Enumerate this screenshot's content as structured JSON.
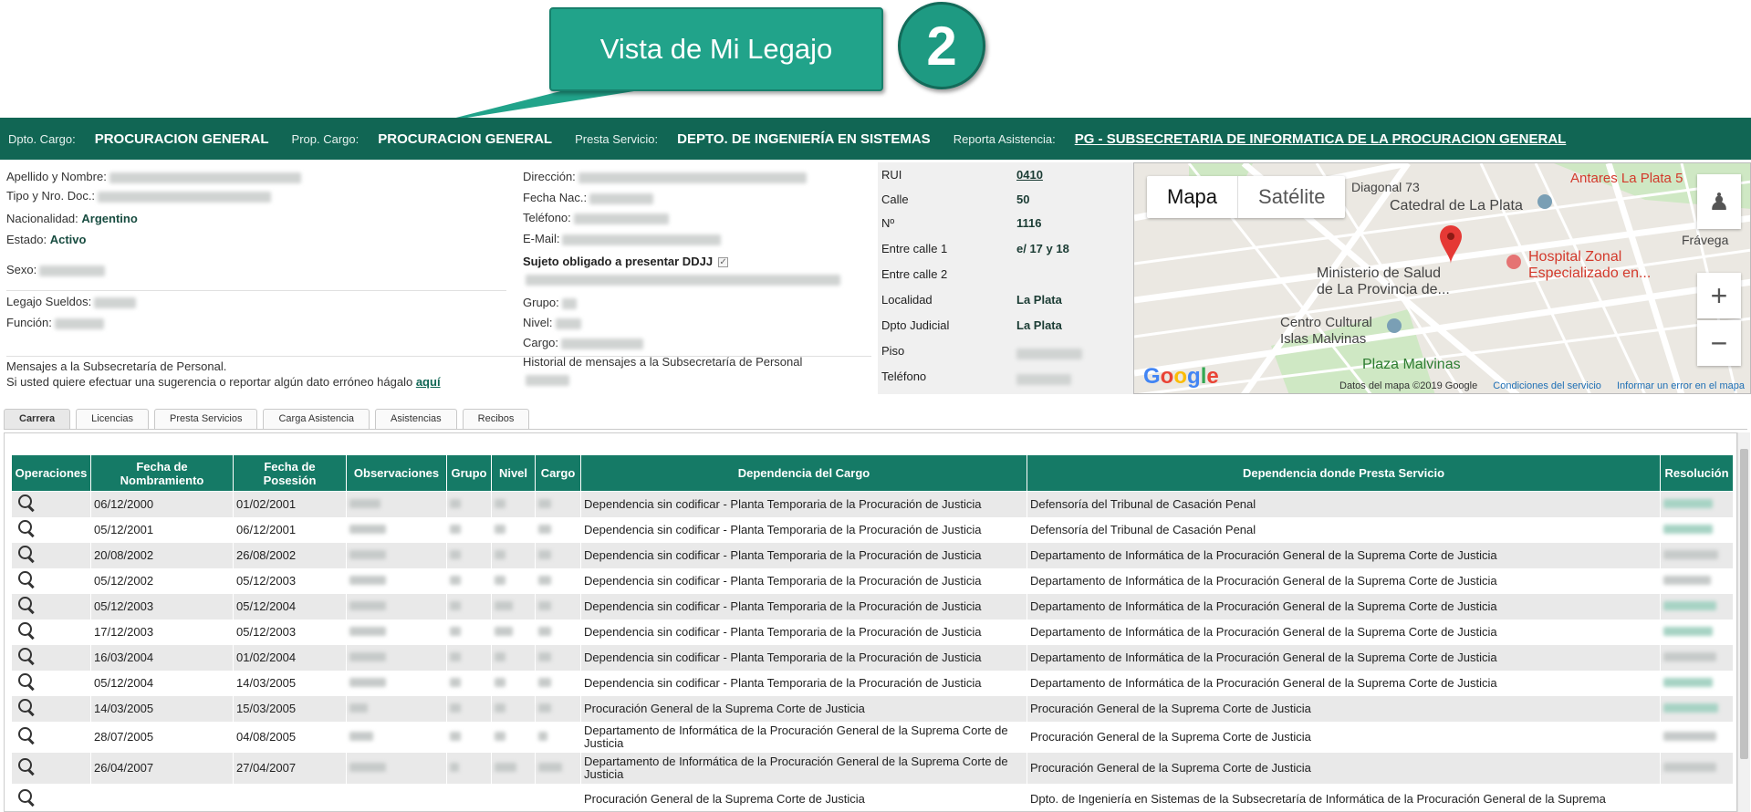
{
  "callout": {
    "text": "Vista de Mi Legajo",
    "badge": "2"
  },
  "topbar": {
    "dpto_label": "Dpto. Cargo:",
    "dpto_value": "PROCURACION GENERAL",
    "prop_label": "Prop. Cargo:",
    "prop_value": "PROCURACION GENERAL",
    "presta_label": "Presta Servicio:",
    "presta_value": "DEPTO. DE INGENIERÍA EN SISTEMAS",
    "reporta_label": "Reporta Asistencia:",
    "reporta_value": "PG - SUBSECRETARIA DE INFORMATICA DE LA PROCURACION GENERAL"
  },
  "personal": {
    "apellido_label": "Apellido y Nombre:",
    "tipo_doc_label": "Tipo y Nro. Doc.:",
    "nacionalidad_label": "Nacionalidad:",
    "nacionalidad_value": "Argentino",
    "estado_label": "Estado:",
    "estado_value": "Activo",
    "sexo_label": "Sexo:",
    "legajo_label": "Legajo Sueldos:",
    "funcion_label": "Función:",
    "mensajes_line1": "Mensajes a la Subsecretaría de Personal.",
    "mensajes_line2": "Si usted quiere efectuar una sugerencia o reportar algún dato erróneo hágalo",
    "mensajes_link": "aquí",
    "direccion_label": "Dirección:",
    "fecha_nac_label": "Fecha Nac.:",
    "telefono_label": "Teléfono:",
    "email_label": "E-Mail:",
    "ddjj_label": "Sujeto obligado a presentar DDJJ",
    "grupo_label": "Grupo:",
    "nivel_label": "Nivel:",
    "cargo_label": "Cargo:",
    "historial_label": "Historial de mensajes a la Subsecretaría de Personal"
  },
  "address": {
    "rui_label": "RUI",
    "rui_value": "0410",
    "calle_label": "Calle",
    "calle_value": "50",
    "nro_label": "Nº",
    "nro_value": "1116",
    "entre1_label": "Entre calle 1",
    "entre1_value": "e/ 17 y 18",
    "entre2_label": "Entre calle 2",
    "localidad_label": "Localidad",
    "localidad_value": "La Plata",
    "dpto_judicial_label": "Dpto Judicial",
    "dpto_judicial_value": "La Plata",
    "piso_label": "Piso",
    "telefono_label": "Teléfono"
  },
  "map": {
    "tab_mapa": "Mapa",
    "tab_satelite": "Satélite",
    "labels": {
      "diagonal73": "Diagonal 73",
      "catedral": "Catedral de La Plata",
      "antares": "Antares La Plata 5",
      "fravega": "Frávega",
      "hospital1": "Hospital Zonal",
      "hospital2": "Especializado en...",
      "ministerio1": "Ministerio de Salud",
      "ministerio2": "de La Provincia de...",
      "centro1": "Centro Cultural",
      "centro2": "Islas Malvinas",
      "plaza": "Plaza Malvinas"
    },
    "google": "Google",
    "datos": "Datos del mapa ©2019 Google",
    "condiciones": "Condiciones del servicio",
    "informar": "Informar un error en el mapa"
  },
  "tabs": [
    "Carrera",
    "Licencias",
    "Presta Servicios",
    "Carga Asistencia",
    "Asistencias",
    "Recibos"
  ],
  "table": {
    "headers": {
      "operaciones": "Operaciones",
      "fecha_nombramiento": "Fecha de Nombramiento",
      "fecha_posesion": "Fecha de Posesión",
      "observaciones": "Observaciones",
      "grupo": "Grupo",
      "nivel": "Nivel",
      "cargo": "Cargo",
      "dependencia_cargo": "Dependencia del Cargo",
      "dependencia_presta": "Dependencia donde Presta Servicio",
      "resolucion": "Resolución"
    },
    "rows": [
      {
        "nombramiento": "06/12/2000",
        "posesion": "01/02/2001",
        "dep_cargo": "Dependencia sin codificar - Planta Temporaria de la Procuración de Justicia",
        "dep_presta": "Defensoría del Tribunal de Casación Penal"
      },
      {
        "nombramiento": "05/12/2001",
        "posesion": "06/12/2001",
        "dep_cargo": "Dependencia sin codificar - Planta Temporaria de la Procuración de Justicia",
        "dep_presta": "Defensoría del Tribunal de Casación Penal"
      },
      {
        "nombramiento": "20/08/2002",
        "posesion": "26/08/2002",
        "dep_cargo": "Dependencia sin codificar - Planta Temporaria de la Procuración de Justicia",
        "dep_presta": "Departamento de Informática de la Procuración General de la Suprema Corte de Justicia"
      },
      {
        "nombramiento": "05/12/2002",
        "posesion": "05/12/2003",
        "dep_cargo": "Dependencia sin codificar - Planta Temporaria de la Procuración de Justicia",
        "dep_presta": "Departamento de Informática de la Procuración General de la Suprema Corte de Justicia"
      },
      {
        "nombramiento": "05/12/2003",
        "posesion": "05/12/2004",
        "dep_cargo": "Dependencia sin codificar - Planta Temporaria de la Procuración de Justicia",
        "dep_presta": "Departamento de Informática de la Procuración General de la Suprema Corte de Justicia"
      },
      {
        "nombramiento": "17/12/2003",
        "posesion": "05/12/2003",
        "dep_cargo": "Dependencia sin codificar - Planta Temporaria de la Procuración de Justicia",
        "dep_presta": "Departamento de Informática de la Procuración General de la Suprema Corte de Justicia"
      },
      {
        "nombramiento": "16/03/2004",
        "posesion": "01/02/2004",
        "dep_cargo": "Dependencia sin codificar - Planta Temporaria de la Procuración de Justicia",
        "dep_presta": "Departamento de Informática de la Procuración General de la Suprema Corte de Justicia"
      },
      {
        "nombramiento": "05/12/2004",
        "posesion": "14/03/2005",
        "dep_cargo": "Dependencia sin codificar - Planta Temporaria de la Procuración de Justicia",
        "dep_presta": "Departamento de Informática de la Procuración General de la Suprema Corte de Justicia"
      },
      {
        "nombramiento": "14/03/2005",
        "posesion": "15/03/2005",
        "dep_cargo": "Procuración General de la Suprema Corte de Justicia",
        "dep_presta": "Procuración General de la Suprema Corte de Justicia"
      },
      {
        "nombramiento": "28/07/2005",
        "posesion": "04/08/2005",
        "dep_cargo": "Departamento de Informática de la Procuración General de la Suprema Corte de Justicia",
        "dep_presta": "Procuración General de la Suprema Corte de Justicia"
      },
      {
        "nombramiento": "26/04/2007",
        "posesion": "27/04/2007",
        "dep_cargo": "Departamento de Informática de la Procuración General de la Suprema Corte de Justicia",
        "dep_presta": "Procuración General de la Suprema Corte de Justicia"
      },
      {
        "nombramiento": "",
        "posesion": "",
        "dep_cargo": "Procuración General de la Suprema Corte de Justicia",
        "dep_presta": "Dpto. de Ingeniería en Sistemas de la Subsecretaría de Informática de la Procuración General de la Suprema"
      }
    ]
  }
}
